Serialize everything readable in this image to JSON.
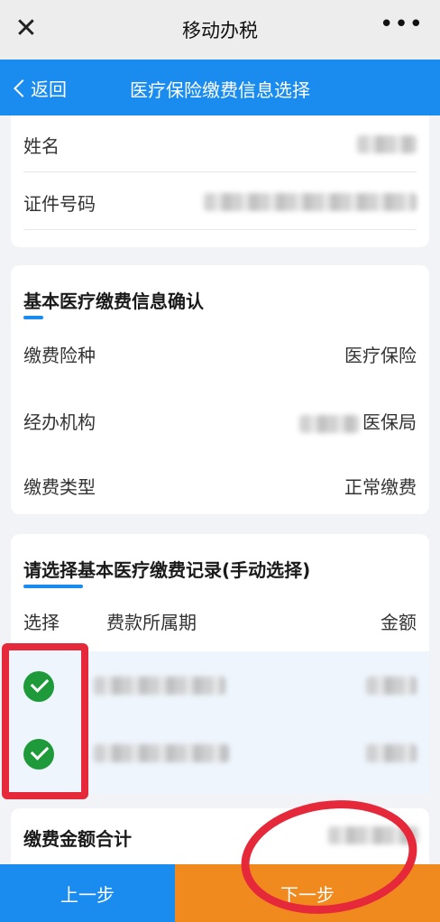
{
  "app": {
    "title": "移动办税",
    "close_icon": "close-icon",
    "more_icon": "more-dots-icon",
    "more_label": "•••"
  },
  "header": {
    "back_label": "返回",
    "title": "医疗保险缴费信息选择"
  },
  "identity": {
    "name_label": "姓名",
    "id_label": "证件号码"
  },
  "basic_info": {
    "title": "基本医疗缴费信息确认",
    "rows": [
      {
        "label": "缴费险种",
        "value": "医疗保险"
      },
      {
        "label": "经办机构",
        "value": "医保局"
      },
      {
        "label": "缴费类型",
        "value": "正常缴费"
      }
    ]
  },
  "records": {
    "title": "请选择基本医疗缴费记录(手动选择)",
    "columns": [
      "选择",
      "费款所属期",
      "金额"
    ],
    "items": [
      {
        "selected": true
      },
      {
        "selected": true
      }
    ]
  },
  "total": {
    "label": "缴费金额合计"
  },
  "footer": {
    "prev_label": "上一步",
    "next_label": "下一步"
  },
  "colors": {
    "primary": "#1a8cf0",
    "accent": "#f08a1e",
    "check": "#1f9a3a",
    "annotation": "#e5283a"
  }
}
